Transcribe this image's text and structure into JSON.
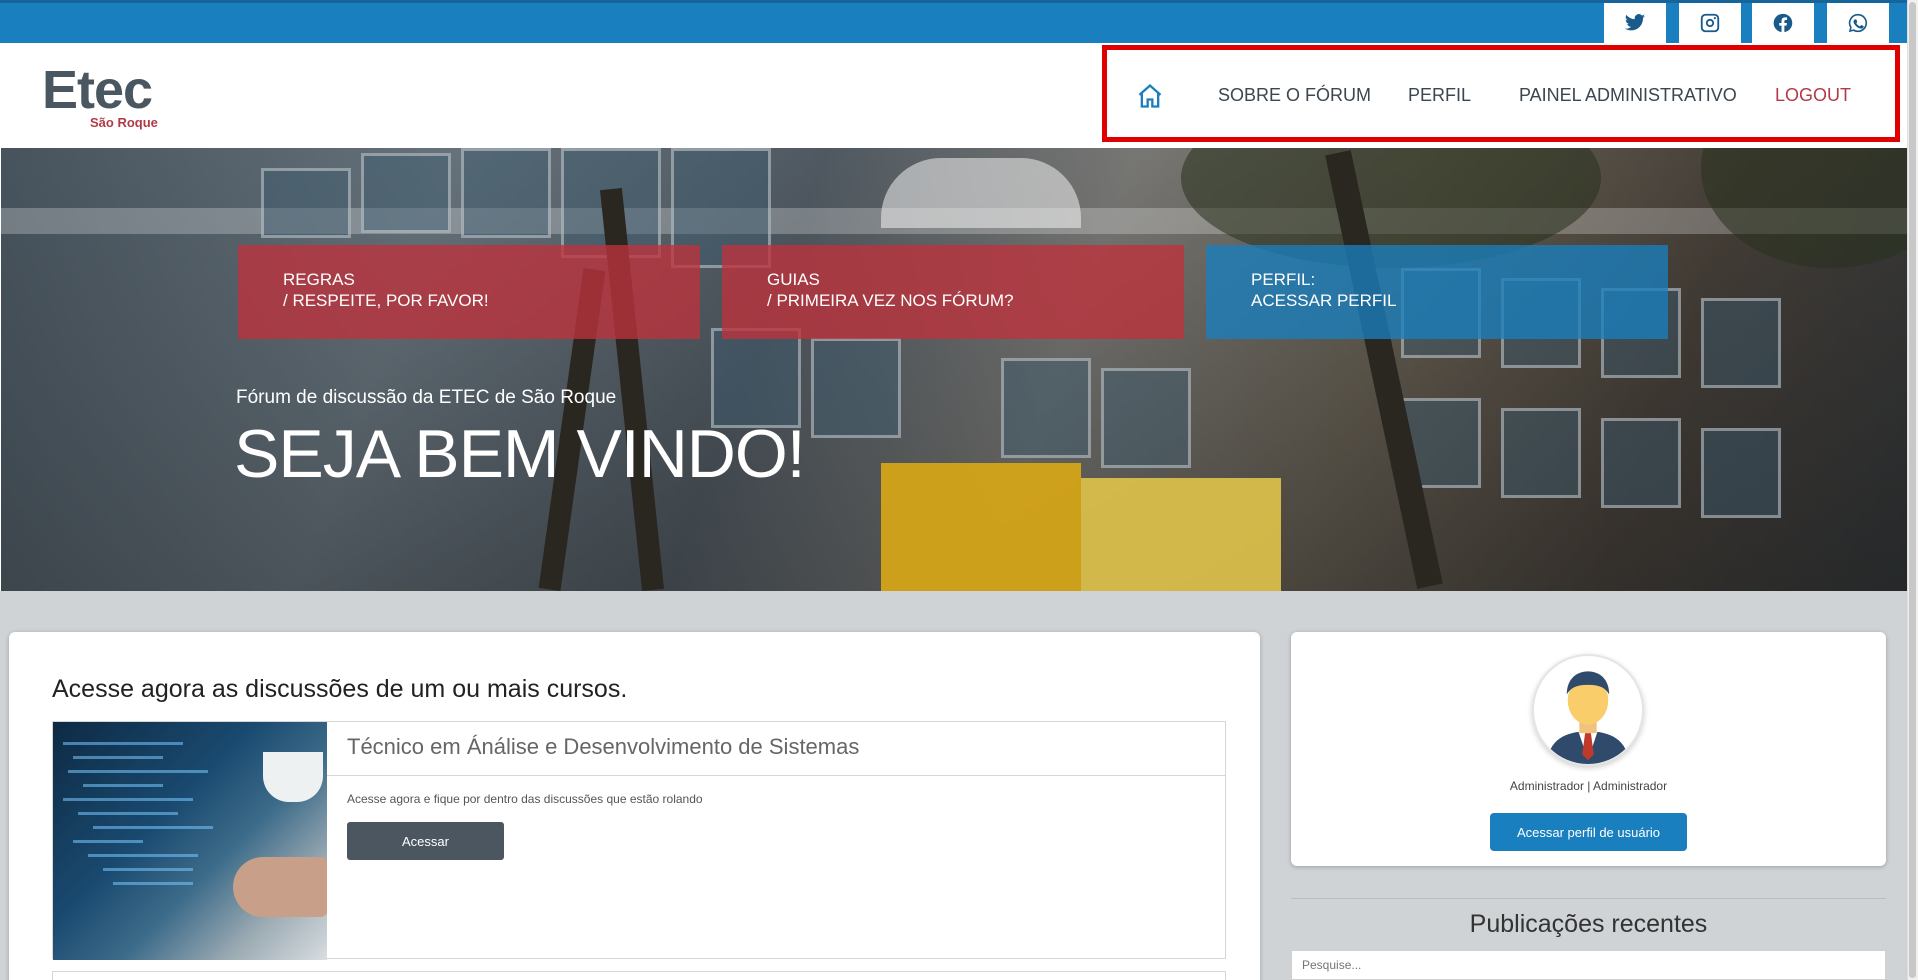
{
  "social": {
    "icons": [
      "twitter-icon",
      "instagram-icon",
      "facebook-icon",
      "whatsapp-icon"
    ]
  },
  "logo": {
    "name": "Etec",
    "city": "São Roque"
  },
  "nav": {
    "home_icon": "home-icon",
    "about": "SOBRE O FÓRUM",
    "profile": "PERFIL",
    "admin": "PAINEL ADMINISTRATIVO",
    "logout": "LOGOUT"
  },
  "hero": {
    "cards": [
      {
        "line1": "REGRAS",
        "line2": "/ RESPEITE, POR FAVOR!"
      },
      {
        "line1": "GUIAS",
        "line2": "/ PRIMEIRA VEZ NOS FÓRUM?"
      },
      {
        "line1": "PERFIL:",
        "line2": "ACESSAR PERFIL"
      }
    ],
    "subtitle": "Fórum de discussão da ETEC de São Roque",
    "title": "SEJA BEM VINDO!"
  },
  "courses": {
    "heading": "Acesse agora as discussões de um ou mais cursos.",
    "items": [
      {
        "title": "Técnico em Ánálise e Desenvolvimento de Sistemas",
        "description": "Acesse agora e fique por dentro das discussões que estão rolando",
        "button": "Acessar"
      }
    ]
  },
  "user": {
    "name": "Administrador | Administrador",
    "profile_button": "Acessar perfil de usuário"
  },
  "recent": {
    "heading": "Publicações recentes",
    "search_placeholder": "Pesquise..."
  },
  "colors": {
    "brand_blue": "#1a7fbe",
    "brand_red": "#b23a48",
    "dark_button": "#4b5660",
    "highlight": "#e00000"
  }
}
